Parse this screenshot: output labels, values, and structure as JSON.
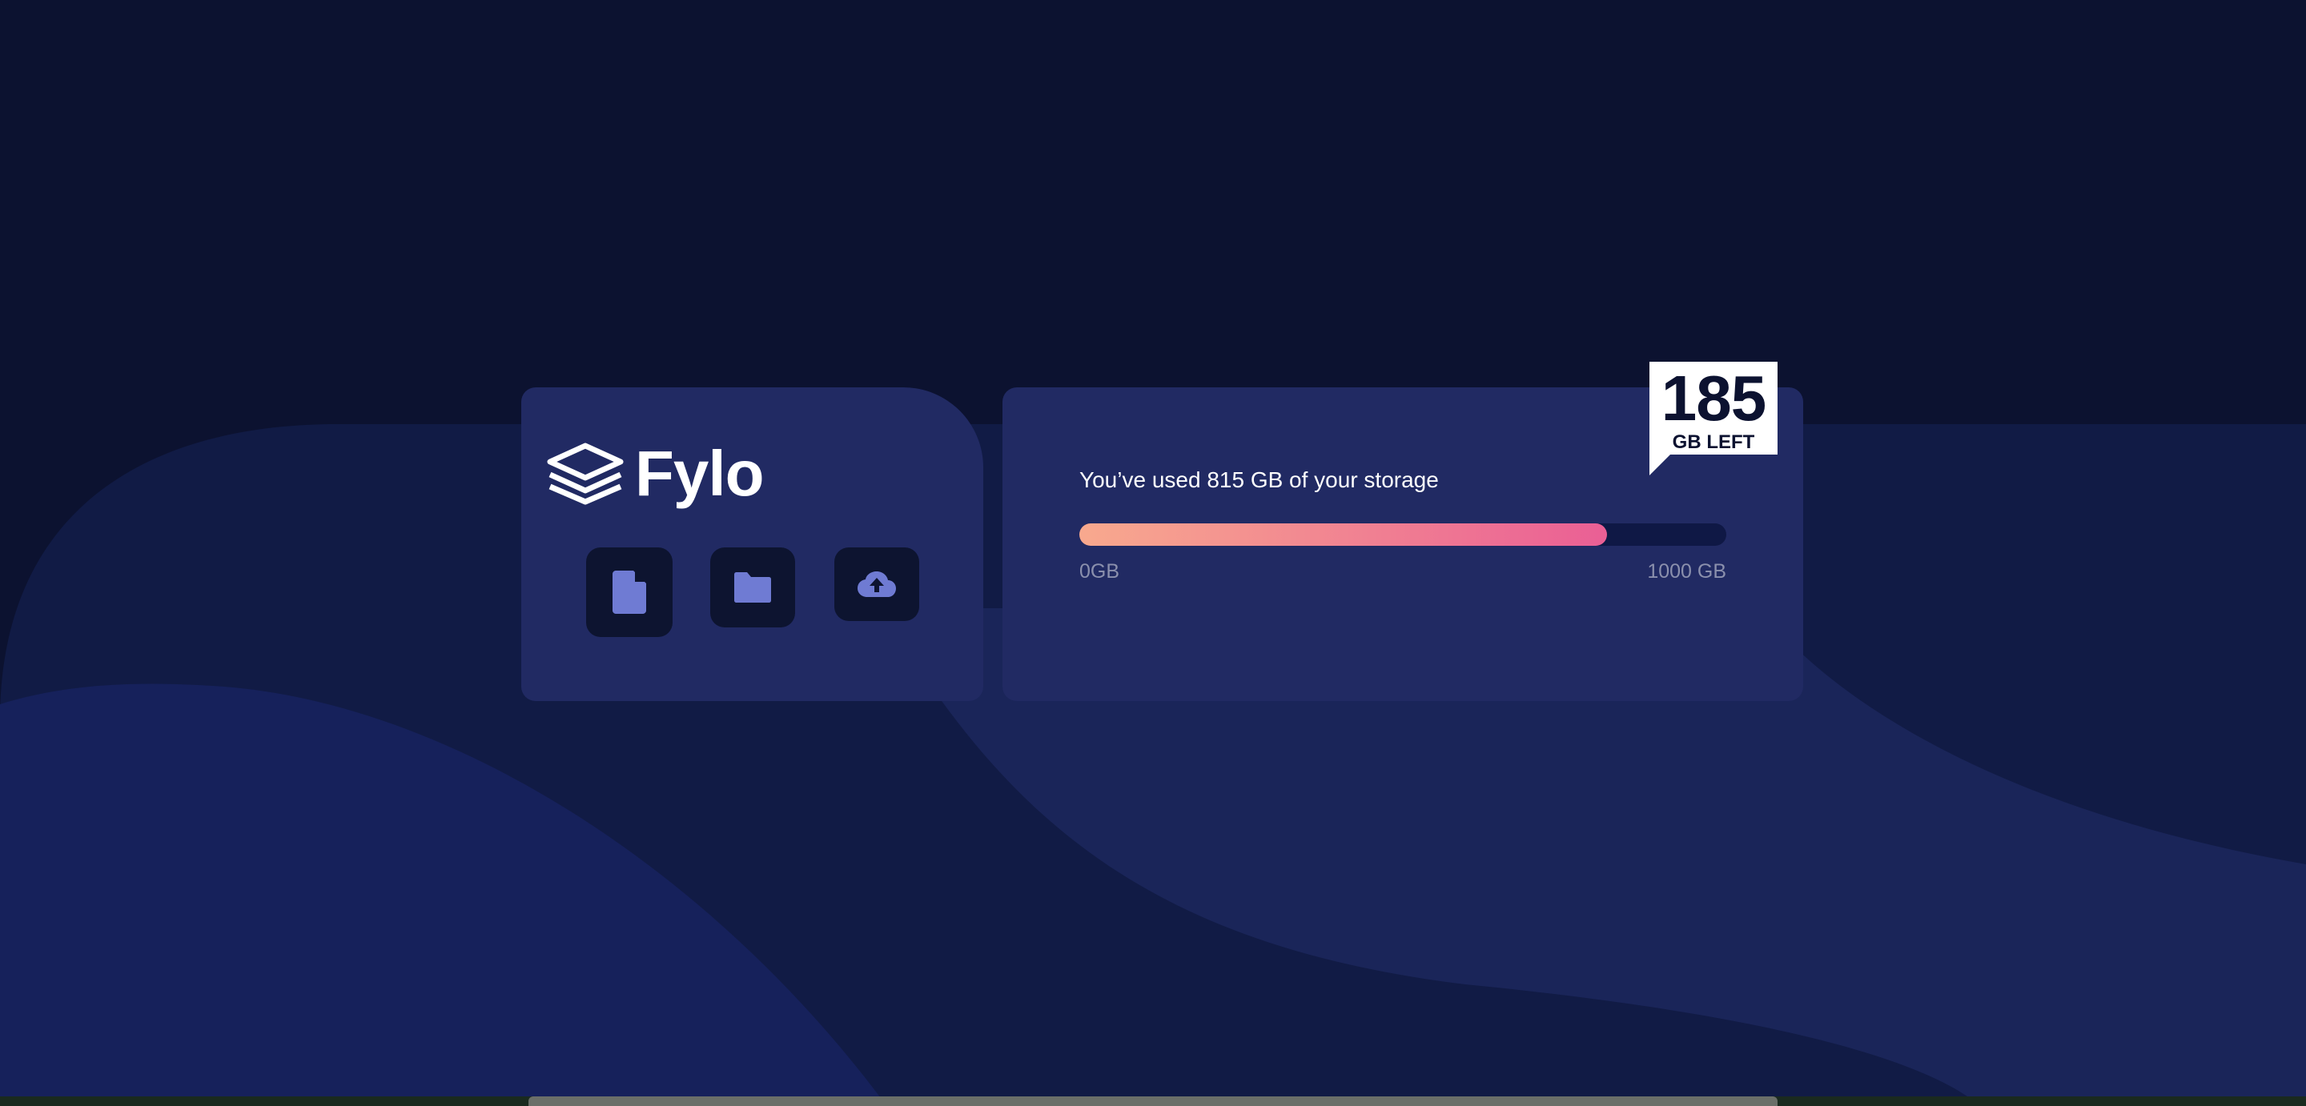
{
  "colors": {
    "page_background": "#0c1230",
    "card_background": "#212a63",
    "icon_button_background": "#0d1430",
    "icon_color": "#6f7bd3",
    "bar_track": "#0f1845",
    "bar_gradient_start": "#f8a98e",
    "bar_gradient_end": "#ea5f95",
    "muted_text": "#8b90ad"
  },
  "brand": {
    "logo_icon": "stacked-layers-icon",
    "name": "Fylo"
  },
  "actions": [
    {
      "icon": "document-icon"
    },
    {
      "icon": "folder-icon"
    },
    {
      "icon": "cloud-upload-icon"
    }
  ],
  "storage": {
    "usage_text": "You’ve used 815 GB of your storage",
    "used_fraction": 0.815,
    "min_label": "0GB",
    "max_label": "1000 GB"
  },
  "badge": {
    "number": "185",
    "label": "GB LEFT"
  }
}
